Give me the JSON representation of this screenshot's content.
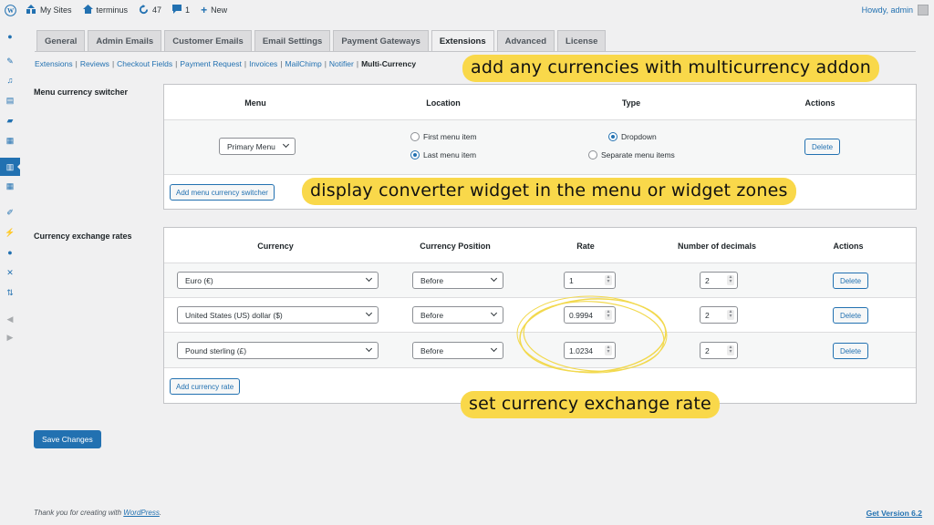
{
  "adminbar": {
    "my_sites": "My Sites",
    "site_name": "terminus",
    "updates_count": "47",
    "comments_count": "1",
    "new_label": "New",
    "howdy": "Howdy, admin"
  },
  "sidebar": {
    "icons": [
      "dashboard-icon",
      "pin-icon",
      "media-icon",
      "pages-icon",
      "comments-icon",
      "calendar-icon",
      "building-icon",
      "calendar-grid-icon",
      "appearance-icon",
      "plugins-icon",
      "users-icon",
      "tools-icon",
      "settings-icon",
      "megaphone-icon",
      "play-icon"
    ],
    "active_index": 6
  },
  "tabs": [
    {
      "label": "General",
      "active": false
    },
    {
      "label": "Admin Emails",
      "active": false
    },
    {
      "label": "Customer Emails",
      "active": false
    },
    {
      "label": "Email Settings",
      "active": false
    },
    {
      "label": "Payment Gateways",
      "active": false
    },
    {
      "label": "Extensions",
      "active": true
    },
    {
      "label": "Advanced",
      "active": false
    },
    {
      "label": "License",
      "active": false
    }
  ],
  "sublinks": [
    "Extensions",
    "Reviews",
    "Checkout Fields",
    "Payment Request",
    "Invoices",
    "MailChimp",
    "Notifier"
  ],
  "sublink_current": "Multi-Currency",
  "menu_switcher": {
    "section_label": "Menu currency switcher",
    "headers": {
      "menu": "Menu",
      "location": "Location",
      "type": "Type",
      "actions": "Actions"
    },
    "menu_value": "Primary Menu",
    "location_options": [
      {
        "label": "First menu item",
        "checked": false
      },
      {
        "label": "Last menu item",
        "checked": true
      }
    ],
    "type_options": [
      {
        "label": "Dropdown",
        "checked": true
      },
      {
        "label": "Separate menu items",
        "checked": false
      }
    ],
    "delete_label": "Delete",
    "add_label": "Add menu currency switcher"
  },
  "exchange_rates": {
    "section_label": "Currency exchange rates",
    "headers": {
      "currency": "Currency",
      "position": "Currency Position",
      "rate": "Rate",
      "decimals": "Number of decimals",
      "actions": "Actions"
    },
    "rows": [
      {
        "currency": "Euro (€)",
        "position": "Before",
        "rate": "1",
        "decimals": "2",
        "action": "Delete"
      },
      {
        "currency": "United States (US) dollar ($)",
        "position": "Before",
        "rate": "0.9994",
        "decimals": "2",
        "action": "Delete"
      },
      {
        "currency": "Pound sterling (£)",
        "position": "Before",
        "rate": "1.0234",
        "decimals": "2",
        "action": "Delete"
      }
    ],
    "add_label": "Add currency rate"
  },
  "annotations": {
    "top": "add any currencies with multicurrency addon",
    "middle": "display converter widget in the menu or widget zones",
    "bottom": "set currency exchange rate",
    "highlight_color": "#f9d84a"
  },
  "save_label": "Save Changes",
  "footer": {
    "thanks_prefix": "Thank you for creating with ",
    "thanks_link": "WordPress",
    "thanks_suffix": ".",
    "version": "Get Version 6.2"
  },
  "colors": {
    "accent": "#2271b1",
    "background": "#f0f0f1"
  }
}
